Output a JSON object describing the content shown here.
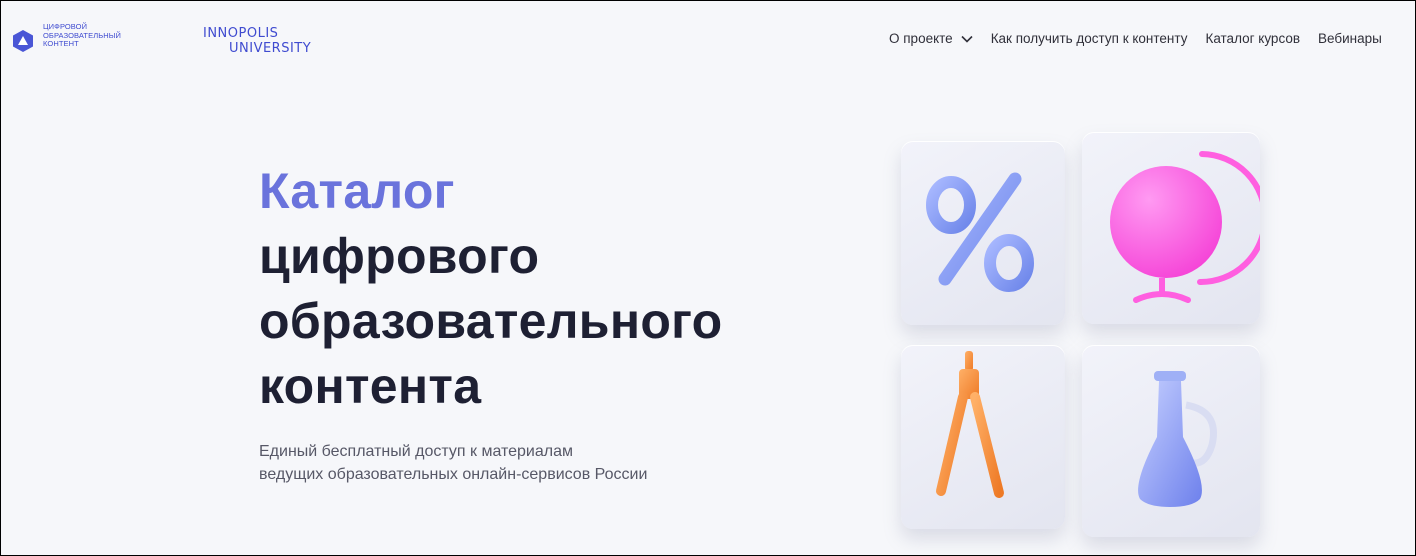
{
  "brand": {
    "logo_lines": [
      "ЦИФРОВОЙ",
      "ОБРАЗОВАТЕЛЬНЫЙ",
      "КОНТЕНТ"
    ],
    "logo_icon": "hexagon-triangle-icon",
    "partner_logo_line1": "INNOPOLIS",
    "partner_logo_line2": "UNIVERSITY",
    "accent_color": "#3f4bd0"
  },
  "nav": {
    "items": [
      {
        "label": "О проекте",
        "has_dropdown": true
      },
      {
        "label": "Как получить доступ к контенту"
      },
      {
        "label": "Каталог курсов"
      },
      {
        "label": "Вебинары"
      }
    ]
  },
  "hero": {
    "title_accent": "Каталог",
    "title_lines": [
      "цифрового",
      "образовательного",
      "контента"
    ],
    "subtitle_lines": [
      "Единый бесплатный доступ к материалам",
      "ведущих образовательных онлайн-сервисов России"
    ],
    "title_accent_color": "#6a73dc",
    "title_color": "#1e2033"
  },
  "illustration": {
    "tiles": [
      {
        "icon": "percent-icon",
        "color": "#7f9af0"
      },
      {
        "icon": "globe-icon",
        "color": "#ff5fe0"
      },
      {
        "icon": "compass-icon",
        "color": "#f28a3a"
      },
      {
        "icon": "flask-icon",
        "color": "#7c8ff0"
      }
    ]
  }
}
